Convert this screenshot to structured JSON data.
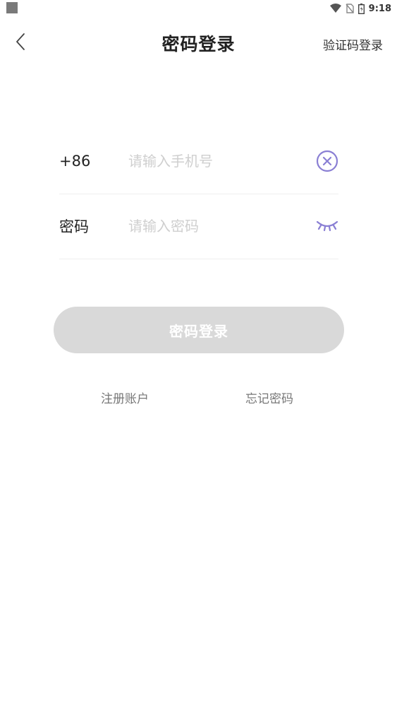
{
  "status_bar": {
    "time": "9:18"
  },
  "nav": {
    "title": "密码登录",
    "action_label": "验证码登录"
  },
  "form": {
    "phone": {
      "prefix": "+86",
      "placeholder": "请输入手机号",
      "value": ""
    },
    "password": {
      "label": "密码",
      "placeholder": "请输入密码",
      "value": ""
    }
  },
  "login_button": {
    "label": "密码登录"
  },
  "links": {
    "register": "注册账户",
    "forgot": "忘记密码"
  },
  "icons": {
    "back": "chevron-left-icon",
    "clear": "clear-circle-icon",
    "visibility": "eye-closed-icon"
  },
  "colors": {
    "accent": "#8a7fd4",
    "button_disabled": "#d9d9d9",
    "placeholder": "#cfcfcf"
  }
}
